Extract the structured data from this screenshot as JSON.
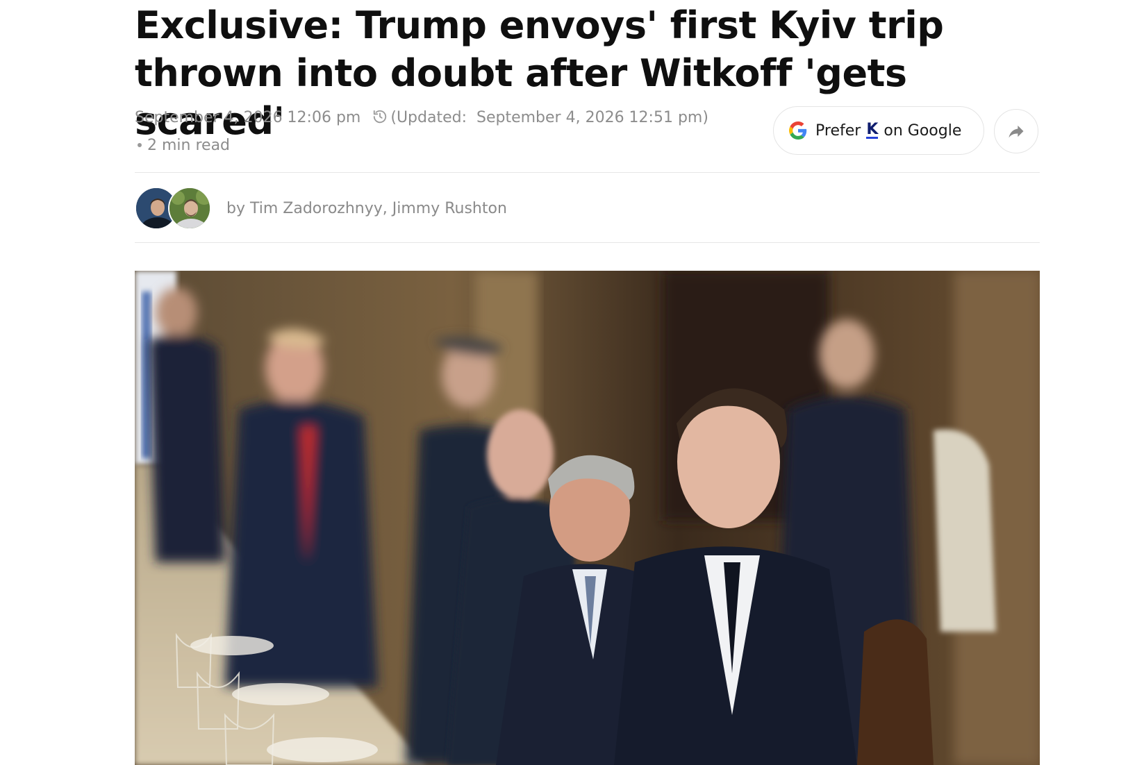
{
  "article": {
    "headline": "Exclusive: Trump envoys' first Kyiv trip thrown into doubt after Witkoff 'gets scared'",
    "published": "September 4, 2026 12:06 pm",
    "updated_prefix": "(Updated:",
    "updated": "September 4, 2026 12:51 pm)",
    "read_time": "2 min read",
    "byline": "by Tim Zadorozhnyy, Jimmy Rushton"
  },
  "actions": {
    "prefer_pre": "Prefer",
    "prefer_brand": "K",
    "prefer_post": "on Google",
    "share_icon": "share-arrow-icon"
  },
  "icons": {
    "google": "google-g-icon",
    "updated": "history-clock-icon"
  },
  "colors": {
    "meta_text": "#8c8c8c",
    "brand_underline": "#2541d8",
    "divider": "#e6e6e6"
  }
}
